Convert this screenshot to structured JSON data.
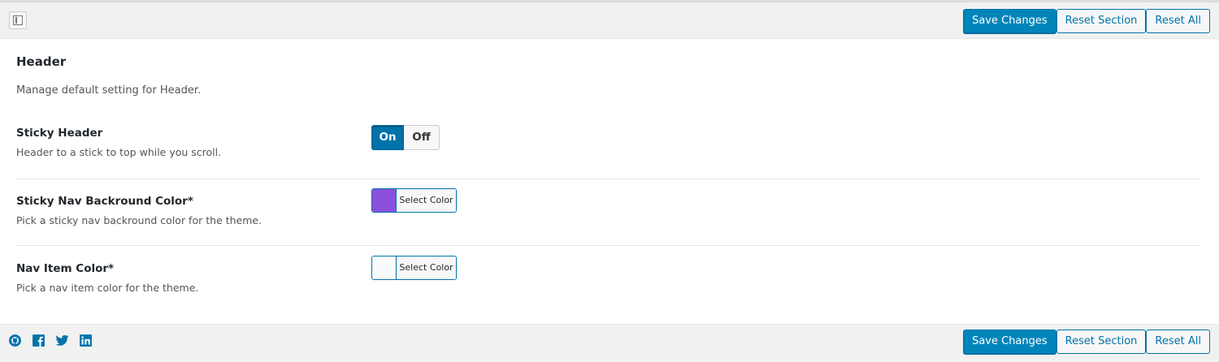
{
  "toolbar": {
    "expand_icon": "expand-layout-icon",
    "save_label": "Save Changes",
    "reset_section_label": "Reset Section",
    "reset_all_label": "Reset All"
  },
  "section": {
    "title": "Header",
    "description": "Manage default setting for Header."
  },
  "fields": [
    {
      "title": "Sticky Header",
      "description": "Header to a stick to top while you scroll.",
      "on_label": "On",
      "off_label": "Off",
      "value": "On"
    },
    {
      "title": "Sticky Nav Backround Color*",
      "description": "Pick a sticky nav backround color for the theme.",
      "button_label": "Select Color",
      "color": "#8a4fdb"
    },
    {
      "title": "Nav Item Color*",
      "description": "Pick a nav item color for the theme.",
      "button_label": "Select Color",
      "color": "#f9fafb"
    }
  ],
  "footer": {
    "social_icons": [
      "github-icon",
      "facebook-icon",
      "twitter-icon",
      "linkedin-icon"
    ],
    "save_label": "Save Changes",
    "reset_section_label": "Reset Section",
    "reset_all_label": "Reset All"
  },
  "colors": {
    "primary": "#0085ba",
    "primary_border": "#0073aa",
    "bar_background": "#f1f1f1"
  }
}
